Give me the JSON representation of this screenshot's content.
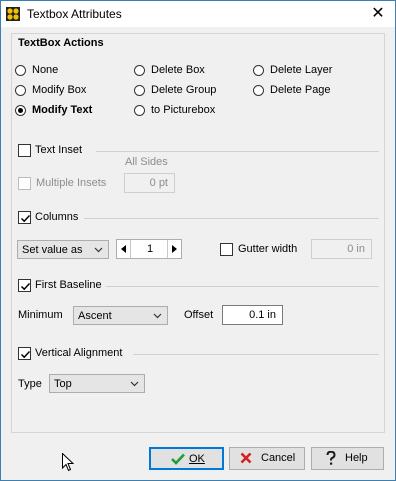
{
  "window": {
    "title": "Textbox Attributes",
    "close_glyph": "✕"
  },
  "actions": {
    "heading": "TextBox Actions",
    "options": [
      "None",
      "Modify Box",
      "Modify Text",
      "Delete Box",
      "Delete Group",
      "to Picturebox",
      "Delete Layer",
      "Delete Page"
    ],
    "selected": "Modify Text"
  },
  "text_inset": {
    "label": "Text Inset",
    "checked": false,
    "multiple_label": "Multiple Insets",
    "multiple_checked": false,
    "all_sides_label": "All Sides",
    "all_sides_value": "0 pt"
  },
  "columns": {
    "label": "Columns",
    "checked": true,
    "mode": "Set value as",
    "value": "1",
    "gutter_label": "Gutter width",
    "gutter_checked": false,
    "gutter_value": "0 in"
  },
  "first_baseline": {
    "label": "First Baseline",
    "checked": true,
    "minimum_label": "Minimum",
    "minimum_value": "Ascent",
    "offset_label": "Offset",
    "offset_value": "0.1 in"
  },
  "vertical_alignment": {
    "label": "Vertical Alignment",
    "checked": true,
    "type_label": "Type",
    "type_value": "Top"
  },
  "buttons": {
    "ok": "OK",
    "cancel": "Cancel",
    "help": "Help"
  },
  "colors": {
    "accent": "#0078d7",
    "ok_check": "#1e9e3a",
    "cancel_x": "#d42020",
    "title_border": "#3c7fb1"
  },
  "icons": [
    "app-icon",
    "close-icon",
    "checkmark-icon",
    "chevron-down-icon",
    "arrow-left-icon",
    "arrow-right-icon",
    "ok-check-icon",
    "cancel-x-icon",
    "help-question-icon",
    "mouse-cursor-icon"
  ]
}
